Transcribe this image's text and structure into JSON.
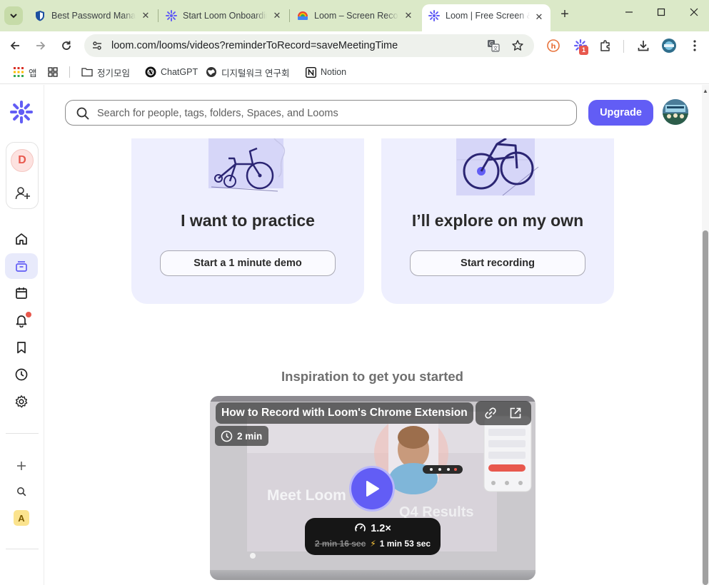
{
  "browser": {
    "tabs": [
      {
        "label": "Best Password Manager",
        "active": false
      },
      {
        "label": "Start Loom Onboarding",
        "active": false
      },
      {
        "label": "Loom – Screen Recorder",
        "active": false
      },
      {
        "label": "Loom | Free Screen & Video Recording",
        "active": true
      }
    ],
    "url": "loom.com/looms/videos?reminderToRecord=saveMeetingTime",
    "extension_badge": "1",
    "bookmarks": [
      {
        "label": "앱",
        "icon": "apps-grid-icon"
      },
      {
        "label": "",
        "icon": "tab-groups-icon"
      },
      {
        "label": "정기모임",
        "icon": "folder-icon"
      },
      {
        "label": "ChatGPT",
        "icon": "chatgpt-icon"
      },
      {
        "label": "디지털워크 연구회",
        "icon": "globe-icon"
      },
      {
        "label": "Notion",
        "icon": "notion-icon"
      }
    ]
  },
  "sidebar": {
    "workspace_initial": "D",
    "space_initial": "A"
  },
  "header": {
    "search_placeholder": "Search for people, tags, folders, Spaces, and Looms",
    "upgrade_label": "Upgrade"
  },
  "cards": [
    {
      "title": "I want to practice",
      "button": "Start a 1 minute demo"
    },
    {
      "title": "I’ll explore on my own",
      "button": "Start recording"
    }
  ],
  "inspiration": {
    "heading": "Inspiration to get you started",
    "video": {
      "title": "How to Record with Loom's Chrome Extension",
      "duration": "2 min",
      "speed": "1.2×",
      "original_time": "2 min 16 sec",
      "fast_time": "1 min 53 sec",
      "thumb_text_main": "Meet Loom",
      "thumb_text_secondary": "Q4 Results"
    }
  },
  "colors": {
    "brand": "#625df5",
    "card_bg": "#eeeffe",
    "tabbar_bg": "#dbe9c8"
  }
}
